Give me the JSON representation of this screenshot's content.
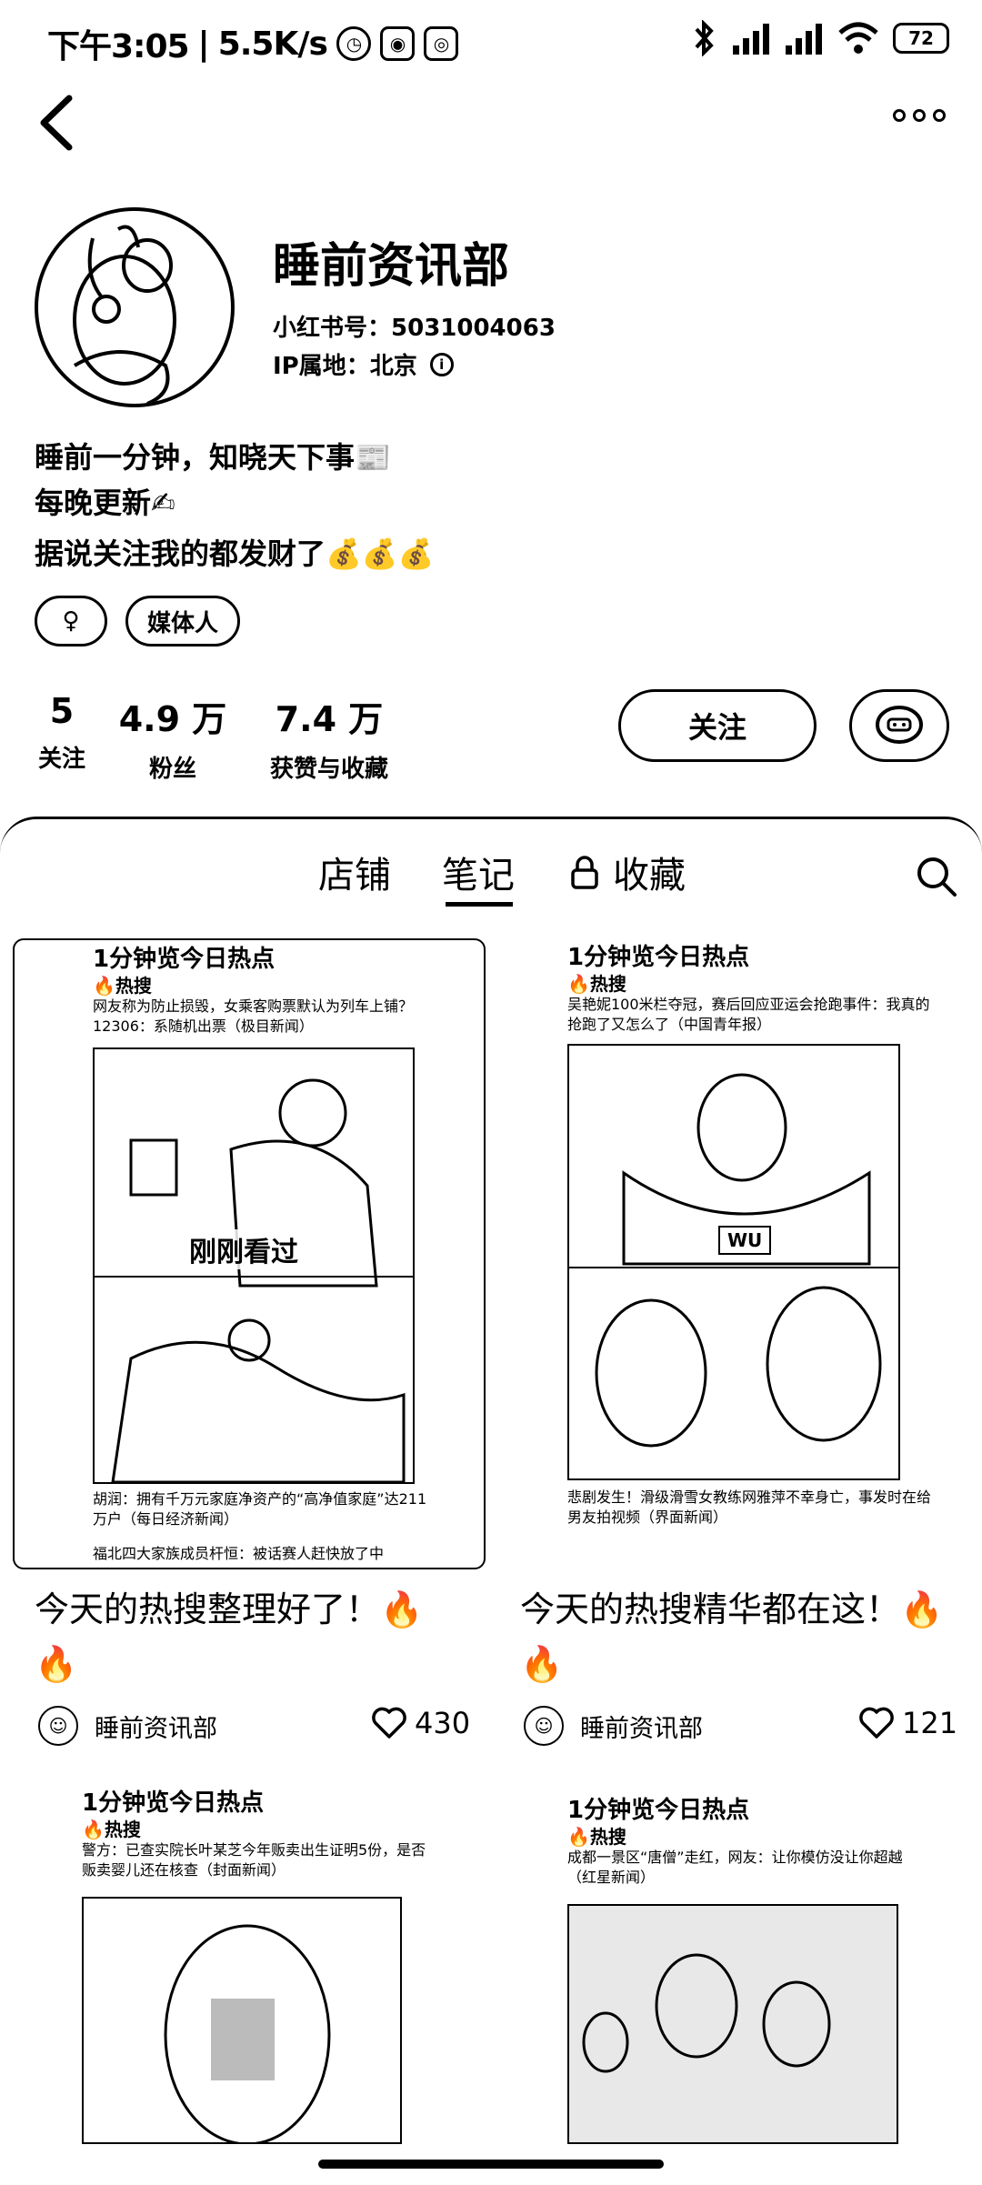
{
  "status": {
    "time": "下午3:05",
    "speed": "5.5K/s",
    "battery": "72"
  },
  "profile": {
    "name": "睡前资讯部",
    "id_label": "小红书号：",
    "id_value": "5031004063",
    "ip_label": "IP属地：",
    "ip_value": "北京",
    "bio": [
      "睡前一分钟，知晓天下事📰",
      "每晚更新✍",
      "据说关注我的都发财了💰💰💰"
    ],
    "tags": [
      "♀",
      "媒体人"
    ],
    "stats": [
      {
        "value": "5",
        "label": "关注"
      },
      {
        "value": "4.9 万",
        "label": "粉丝"
      },
      {
        "value": "7.4 万",
        "label": "获赞与收藏"
      }
    ],
    "follow_label": "关注"
  },
  "tabs": [
    {
      "label": "店铺"
    },
    {
      "label": "笔记"
    },
    {
      "label": "收藏"
    }
  ],
  "notes": [
    {
      "header": "1分钟览今日热点",
      "sub": "🔥热搜",
      "cap1": "网友称为防止损毁，女乘客购票默认为列车上铺？12306：系随机出票（极目新闻）",
      "cap2": "胡润：拥有千万元家庭净资产的“高净值家庭”达211万户（每日经济新闻）",
      "cap3": "福北四大家族成员杆恒：被话赛人赶快放了中",
      "overlay": "刚刚看过",
      "title": "今天的热搜整理好了！🔥🔥",
      "author": "睡前资讯部",
      "likes": "430"
    },
    {
      "header": "1分钟览今日热点",
      "sub": "🔥热搜",
      "cap1": "吴艳妮100米栏夺冠，赛后回应亚运会抢跑事件：我真的抢跑了又怎么了（中国青年报）",
      "cap2": "悲剧发生！滑级滑雪女教练网雅萍不幸身亡，事发时在给男友拍视频（界面新闻）",
      "badge": "WU",
      "title": "今天的热搜精华都在这！🔥🔥",
      "author": "睡前资讯部",
      "likes": "121"
    },
    {
      "header": "1分钟览今日热点",
      "sub": "🔥热搜",
      "cap1": "警方：已查实院长叶某芝今年贩卖出生证明5份，是否贩卖婴儿还在核查（封面新闻）"
    },
    {
      "header": "1分钟览今日热点",
      "sub": "🔥热搜",
      "cap1": "成都一景区“唐僧”走红，网友：让你模仿没让你超越（红星新闻）"
    }
  ]
}
